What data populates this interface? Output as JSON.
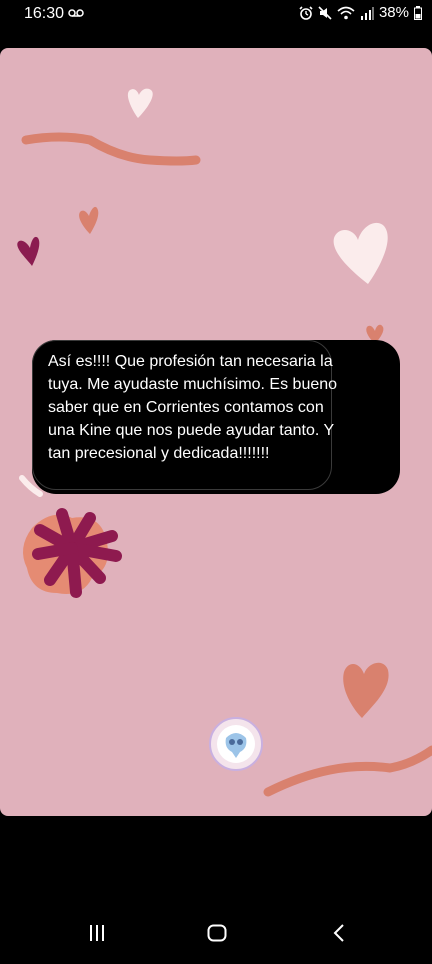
{
  "status_bar": {
    "time": "16:30",
    "battery_percent": "38%",
    "icons": [
      "voicemail-icon",
      "alarm-icon",
      "mute-icon",
      "wifi-icon",
      "signal-icon",
      "battery-icon"
    ]
  },
  "story": {
    "message": "Así es!!!! Que profesión tan necesaria la tuya. Me ayudaste muchísimo. Es bueno saber que en Corrientes contamos con una Kine que nos puede ayudar tanto. Y tan precesional y dedicada!!!!!!!",
    "background_color": "#e0b1bb",
    "avatar_icon": "profile-avatar-icon"
  },
  "nav_bar": {
    "icons": [
      "recent-apps-icon",
      "home-icon",
      "back-icon"
    ]
  }
}
